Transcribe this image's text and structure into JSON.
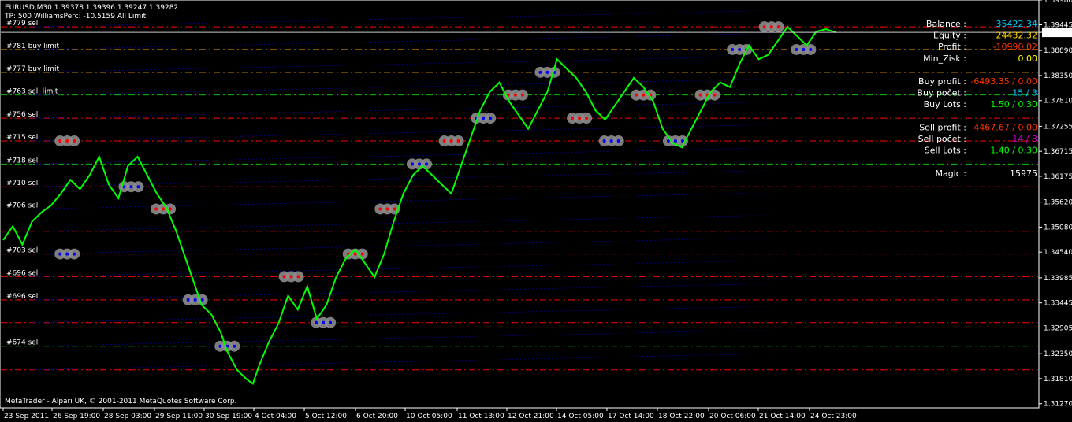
{
  "header": {
    "line1": "EURUSD,M30  1.39378 1.39396 1.39247 1.39282",
    "line2": "TP: 500 WilliamsPerc: -10.5159 All Limit"
  },
  "footer": {
    "copyright": "MetaTrader - Alpari UK, © 2001-2011 MetaQuotes Software Corp."
  },
  "colors": {
    "background": "#000000",
    "price_line": "#00ff00",
    "axis": "#ffffff",
    "sell_level": "#ff0000",
    "buy_level": "#0000ff",
    "limit_level": "#ffa500",
    "green_level": "#00c000",
    "marker_ring": "#8c8c8c"
  },
  "order_labels": [
    {
      "text": "#779 sell",
      "price": 1.394
    },
    {
      "text": "#781 buy limit",
      "price": 1.3891
    },
    {
      "text": "#777 buy limit",
      "price": 1.3842
    },
    {
      "text": "#763 sell limit",
      "price": 1.3793
    },
    {
      "text": "#756 sell",
      "price": 1.3743
    },
    {
      "text": "#715 sell",
      "price": 1.3694
    },
    {
      "text": "#718 sell",
      "price": 1.3644
    },
    {
      "text": "#710 sell",
      "price": 1.3595
    },
    {
      "text": "#706 sell",
      "price": 1.3547
    },
    {
      "text": "#703 sell",
      "price": 1.345
    },
    {
      "text": "#696 sell",
      "price": 1.3401
    },
    {
      "text": "#696 sell",
      "price": 1.3351
    },
    {
      "text": "#674 sell",
      "price": 1.3251
    }
  ],
  "info_panel": [
    {
      "label": "Balance :",
      "value": "35422.34",
      "color": "#00ccff"
    },
    {
      "label": "Equity :",
      "value": "24432.32",
      "color": "#ffd700"
    },
    {
      "label": "Profit :",
      "value": "-10990.02",
      "color": "#ff3300"
    },
    {
      "label": "Min_Zisk :",
      "value": "0.00",
      "color": "#ffff00"
    },
    {
      "label": "",
      "value": "",
      "color": "#ffffff"
    },
    {
      "label": "Buy profit :",
      "value": "-6493.35 / 0.00",
      "color": "#ff3300"
    },
    {
      "label": "Buy počet :",
      "value": "15 / 3",
      "color": "#00ccff"
    },
    {
      "label": "Buy Lots :",
      "value": "1.50 / 0.30",
      "color": "#00ff00"
    },
    {
      "label": "",
      "value": "",
      "color": "#ffffff"
    },
    {
      "label": "Sell profit :",
      "value": "-4467.67 / 0.00",
      "color": "#ff3300"
    },
    {
      "label": "Sell počet :",
      "value": "14 / 3",
      "color": "#cc00cc"
    },
    {
      "label": "Sell Lots :",
      "value": "1.40 / 0.30",
      "color": "#00ff00"
    },
    {
      "label": "",
      "value": "",
      "color": "#ffffff"
    },
    {
      "label": "Magic :",
      "value": "15975",
      "color": "#ffffff"
    }
  ],
  "chart_data": {
    "type": "line",
    "symbol": "EURUSD",
    "timeframe": "M30",
    "ylim": [
      1.3118,
      1.3998
    ],
    "y_ticks": [
      "1.39980",
      "1.39445",
      "1.39282",
      "1.38890",
      "1.38350",
      "1.37810",
      "1.37255",
      "1.36715",
      "1.36175",
      "1.35620",
      "1.35080",
      "1.34540",
      "1.33985",
      "1.33445",
      "1.32905",
      "1.32350",
      "1.31810",
      "1.31270"
    ],
    "current_price": "1.39282",
    "x_ticks": [
      "23 Sep 2011",
      "26 Sep 19:00",
      "28 Sep 03:00",
      "29 Sep 11:00",
      "30 Sep 19:00",
      "4 Oct 04:00",
      "5 Oct 12:00",
      "6 Oct 20:00",
      "10 Oct 05:00",
      "11 Oct 13:00",
      "12 Oct 21:00",
      "14 Oct 05:00",
      "17 Oct 14:00",
      "18 Oct 22:00",
      "20 Oct 06:00",
      "21 Oct 14:00",
      "24 Oct 23:00"
    ],
    "levels": [
      {
        "price": 1.394,
        "color": "#ff0000"
      },
      {
        "price": 1.3891,
        "color": "#ffa500"
      },
      {
        "price": 1.3842,
        "color": "#ffa500"
      },
      {
        "price": 1.3793,
        "color": "#00c000"
      },
      {
        "price": 1.3743,
        "color": "#ff0000"
      },
      {
        "price": 1.3694,
        "color": "#ff0000"
      },
      {
        "price": 1.3644,
        "color": "#00c000"
      },
      {
        "price": 1.3595,
        "color": "#ff0000"
      },
      {
        "price": 1.3547,
        "color": "#ff0000"
      },
      {
        "price": 1.3499,
        "color": "#ff0000"
      },
      {
        "price": 1.345,
        "color": "#ff0000"
      },
      {
        "price": 1.3401,
        "color": "#ff0000"
      },
      {
        "price": 1.3351,
        "color": "#ff0000"
      },
      {
        "price": 1.3302,
        "color": "#ff0000"
      },
      {
        "price": 1.3251,
        "color": "#00c000"
      },
      {
        "price": 1.32,
        "color": "#ff0000"
      }
    ],
    "price_path": [
      [
        0,
        1.348
      ],
      [
        0.3,
        1.351
      ],
      [
        0.6,
        1.347
      ],
      [
        0.9,
        1.352
      ],
      [
        1.2,
        1.354
      ],
      [
        1.5,
        1.3555
      ],
      [
        1.8,
        1.358
      ],
      [
        2.1,
        1.361
      ],
      [
        2.4,
        1.359
      ],
      [
        2.7,
        1.362
      ],
      [
        3.0,
        1.366
      ],
      [
        3.3,
        1.36
      ],
      [
        3.6,
        1.357
      ],
      [
        3.9,
        1.364
      ],
      [
        4.2,
        1.366
      ],
      [
        4.5,
        1.362
      ],
      [
        4.8,
        1.358
      ],
      [
        5.1,
        1.355
      ],
      [
        5.4,
        1.35
      ],
      [
        5.7,
        1.344
      ],
      [
        6.0,
        1.338
      ],
      [
        6.2,
        1.334
      ],
      [
        6.5,
        1.332
      ],
      [
        6.8,
        1.328
      ],
      [
        7.0,
        1.324
      ],
      [
        7.3,
        1.32
      ],
      [
        7.6,
        1.318
      ],
      [
        7.8,
        1.317
      ],
      [
        8.0,
        1.321
      ],
      [
        8.3,
        1.326
      ],
      [
        8.6,
        1.33
      ],
      [
        8.9,
        1.336
      ],
      [
        9.2,
        1.333
      ],
      [
        9.5,
        1.338
      ],
      [
        9.8,
        1.331
      ],
      [
        10.1,
        1.334
      ],
      [
        10.4,
        1.34
      ],
      [
        10.7,
        1.344
      ],
      [
        11.0,
        1.346
      ],
      [
        11.3,
        1.343
      ],
      [
        11.6,
        1.34
      ],
      [
        11.9,
        1.345
      ],
      [
        12.2,
        1.352
      ],
      [
        12.5,
        1.358
      ],
      [
        12.8,
        1.362
      ],
      [
        13.1,
        1.364
      ],
      [
        13.4,
        1.362
      ],
      [
        13.7,
        1.36
      ],
      [
        14.0,
        1.358
      ],
      [
        14.3,
        1.364
      ],
      [
        14.6,
        1.37
      ],
      [
        14.9,
        1.376
      ],
      [
        15.2,
        1.38
      ],
      [
        15.5,
        1.382
      ],
      [
        15.8,
        1.378
      ],
      [
        16.1,
        1.375
      ],
      [
        16.4,
        1.372
      ],
      [
        16.7,
        1.376
      ],
      [
        17.0,
        1.38
      ],
      [
        17.3,
        1.387
      ],
      [
        17.6,
        1.385
      ],
      [
        17.9,
        1.383
      ],
      [
        18.2,
        1.38
      ],
      [
        18.5,
        1.376
      ],
      [
        18.8,
        1.374
      ],
      [
        19.1,
        1.377
      ],
      [
        19.4,
        1.38
      ],
      [
        19.7,
        1.383
      ],
      [
        20.0,
        1.381
      ],
      [
        20.3,
        1.378
      ],
      [
        20.6,
        1.372
      ],
      [
        20.9,
        1.369
      ],
      [
        21.2,
        1.368
      ],
      [
        21.5,
        1.372
      ],
      [
        21.8,
        1.376
      ],
      [
        22.1,
        1.38
      ],
      [
        22.4,
        1.382
      ],
      [
        22.7,
        1.381
      ],
      [
        23.0,
        1.386
      ],
      [
        23.3,
        1.39
      ],
      [
        23.6,
        1.387
      ],
      [
        23.9,
        1.388
      ],
      [
        24.2,
        1.391
      ],
      [
        24.5,
        1.394
      ],
      [
        24.8,
        1.392
      ],
      [
        25.1,
        1.39
      ],
      [
        25.4,
        1.393
      ],
      [
        25.7,
        1.3935
      ],
      [
        26.0,
        1.3928
      ]
    ],
    "trade_markers": [
      {
        "t": 2,
        "price": 1.345,
        "side": "buy"
      },
      {
        "t": 2,
        "price": 1.3694,
        "side": "sell"
      },
      {
        "t": 4,
        "price": 1.3595,
        "side": "buy"
      },
      {
        "t": 5,
        "price": 1.3547,
        "side": "sell"
      },
      {
        "t": 6,
        "price": 1.3351,
        "side": "buy"
      },
      {
        "t": 7,
        "price": 1.3251,
        "side": "buy"
      },
      {
        "t": 9,
        "price": 1.3401,
        "side": "sell"
      },
      {
        "t": 10,
        "price": 1.3302,
        "side": "buy"
      },
      {
        "t": 11,
        "price": 1.345,
        "side": "sell"
      },
      {
        "t": 12,
        "price": 1.3547,
        "side": "sell"
      },
      {
        "t": 13,
        "price": 1.3644,
        "side": "buy"
      },
      {
        "t": 14,
        "price": 1.3694,
        "side": "sell"
      },
      {
        "t": 15,
        "price": 1.3743,
        "side": "buy"
      },
      {
        "t": 16,
        "price": 1.3793,
        "side": "sell"
      },
      {
        "t": 17,
        "price": 1.3842,
        "side": "buy"
      },
      {
        "t": 18,
        "price": 1.3743,
        "side": "sell"
      },
      {
        "t": 19,
        "price": 1.3694,
        "side": "buy"
      },
      {
        "t": 20,
        "price": 1.3793,
        "side": "sell"
      },
      {
        "t": 21,
        "price": 1.3694,
        "side": "buy"
      },
      {
        "t": 22,
        "price": 1.3793,
        "side": "sell"
      },
      {
        "t": 23,
        "price": 1.3891,
        "side": "buy"
      },
      {
        "t": 24,
        "price": 1.394,
        "side": "sell"
      },
      {
        "t": 25,
        "price": 1.3891,
        "side": "buy"
      }
    ]
  }
}
